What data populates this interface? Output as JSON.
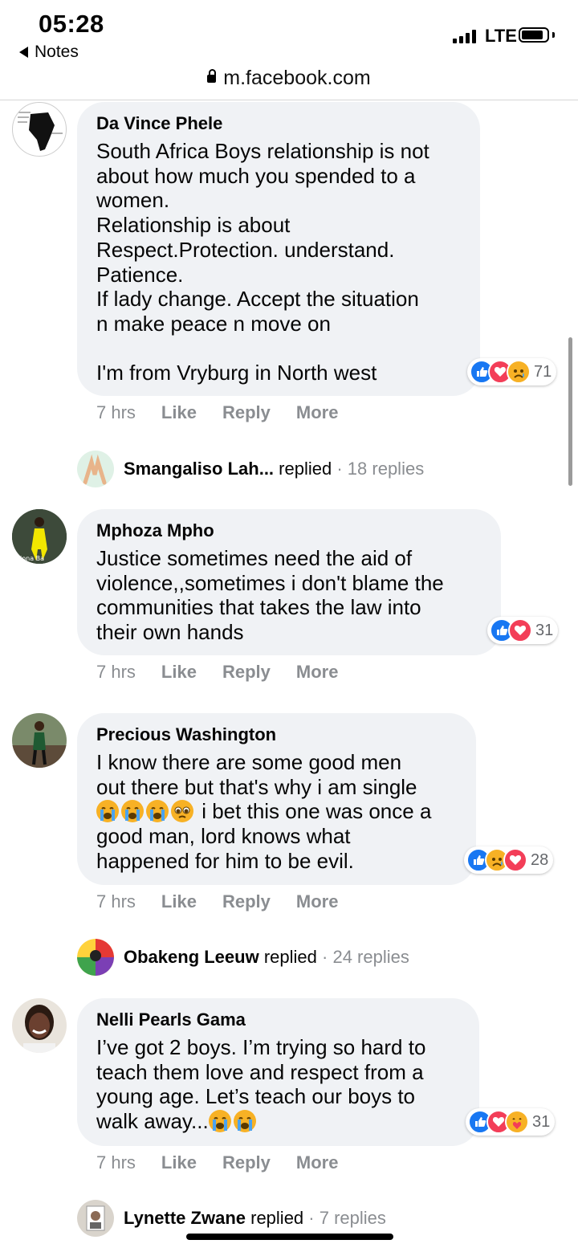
{
  "status": {
    "time": "05:28",
    "back_label": "Notes",
    "network": "LTE"
  },
  "browser": {
    "url": "m.facebook.com"
  },
  "comments": [
    {
      "name": "Da Vince Phele",
      "text": "South Africa Boys relationship is not\nabout how much you spended to a\nwomen.\nRelationship is about\nRespect.Protection. understand.\nPatience.\nIf lady change. Accept the situation\nn make peace n move on\n\nI'm from Vryburg in North west",
      "reaction_count": "71",
      "reactions": [
        "like-icon",
        "love-icon",
        "sad-icon"
      ],
      "time": "7 hrs",
      "like": "Like",
      "reply": "Reply",
      "more": "More",
      "replies": {
        "name": "Smangaliso Lah...",
        "verb": "replied",
        "sep": "·",
        "count": "18 replies"
      }
    },
    {
      "name": "Mphoza Mpho",
      "text": "Justice sometimes need the aid of\nviolence,,sometimes i don't blame the\ncommunities that takes the law into\ntheir own hands",
      "reaction_count": "31",
      "reactions": [
        "like-icon",
        "love-icon"
      ],
      "time": "7 hrs",
      "like": "Like",
      "reply": "Reply",
      "more": "More"
    },
    {
      "name": "Precious Washington",
      "text_line1": "I know there are some good men",
      "text_line2": "out there but that's why i am single",
      "text_line3_emoji": [
        "loudly-crying-emoji",
        "loudly-crying-emoji",
        "loudly-crying-emoji",
        "pleading-emoji"
      ],
      "text_line3": " i bet this one was once a",
      "text_line4": "good man, lord knows what",
      "text_line5": "happened for him to be evil.",
      "reaction_count": "28",
      "reactions": [
        "like-icon",
        "sad-icon",
        "love-icon"
      ],
      "time": "7 hrs",
      "like": "Like",
      "reply": "Reply",
      "more": "More",
      "replies": {
        "name": "Obakeng Leeuw",
        "verb": "replied",
        "sep": "·",
        "count": "24 replies"
      }
    },
    {
      "name": "Nelli Pearls Gama",
      "text_line1": "I’ve got 2 boys. I’m trying so hard to",
      "text_line2": "teach them love and respect from a",
      "text_line3": "young age. Let’s teach our boys to",
      "text_line4": "walk away...",
      "text_line4_emoji": [
        "loudly-crying-emoji",
        "loudly-crying-emoji"
      ],
      "reaction_count": "31",
      "reactions": [
        "like-icon",
        "love-icon",
        "care-icon"
      ],
      "time": "7 hrs",
      "like": "Like",
      "reply": "Reply",
      "more": "More",
      "replies": {
        "name": "Lynette Zwane",
        "verb": "replied",
        "sep": "·",
        "count": "7 replies"
      }
    }
  ],
  "colors": {
    "bubble": "#f0f2f5",
    "like": "#1877f2",
    "love": "#f33e58",
    "sad": "#f7b125",
    "meta": "#8a8d91"
  }
}
